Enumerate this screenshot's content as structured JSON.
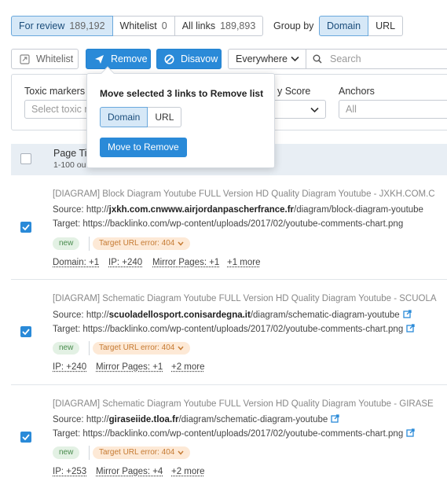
{
  "tabs": [
    {
      "label": "For review",
      "count": "189,192"
    },
    {
      "label": "Whitelist",
      "count": "0"
    },
    {
      "label": "All links",
      "count": "189,893"
    }
  ],
  "group_by": {
    "label": "Group by",
    "options": [
      "Domain",
      "URL"
    ],
    "selected": "Domain"
  },
  "actions": {
    "whitelist": "Whitelist",
    "remove": "Remove",
    "disavow": "Disavow",
    "scope": "Everywhere",
    "search_placeholder": "Search"
  },
  "filters": {
    "toxic_markers_label": "Toxic markers",
    "toxic_markers_placeholder": "Select toxic m",
    "score_label": "y Score",
    "anchors_label": "Anchors",
    "anchors_value": "All"
  },
  "table_header": {
    "title": "Page Tit",
    "subtitle": "1-100 ou"
  },
  "rows": [
    {
      "title": "[DIAGRAM] Block Diagram Youtube FULL Version HD Quality Diagram Youtube - JXKH.COM.C",
      "source_label": "Source:",
      "source_prefix": "http://",
      "source_domain": "jxkh.com.cnwww.airjordanpascherfrance.fr",
      "source_path": "/diagram/block-diagram-youtube",
      "target_label": "Target:",
      "target_url": "https://backlinko.com/wp-content/uploads/2017/02/youtube-comments-chart.png",
      "badge": "new",
      "error": "Target URL error: 404",
      "metrics": [
        "Domain: +1",
        "IP: +240",
        "Mirror Pages: +1",
        "+1 more"
      ]
    },
    {
      "title": "[DIAGRAM] Schematic Diagram Youtube FULL Version HD Quality Diagram Youtube - SCUOLA",
      "source_label": "Source:",
      "source_prefix": "http://",
      "source_domain": "scuoladellosport.conisardegna.it",
      "source_path": "/diagram/schematic-diagram-youtube",
      "target_label": "Target:",
      "target_url": "https://backlinko.com/wp-content/uploads/2017/02/youtube-comments-chart.png",
      "badge": "new",
      "error": "Target URL error: 404",
      "metrics": [
        "IP: +240",
        "Mirror Pages: +1",
        "+2 more"
      ]
    },
    {
      "title": "[DIAGRAM] Schematic Diagram Youtube FULL Version HD Quality Diagram Youtube - GIRASE",
      "source_label": "Source:",
      "source_prefix": "http://",
      "source_domain": "giraseiide.tloa.fr",
      "source_path": "/diagram/schematic-diagram-youtube",
      "target_label": "Target:",
      "target_url": "https://backlinko.com/wp-content/uploads/2017/02/youtube-comments-chart.png",
      "badge": "new",
      "error": "Target URL error: 404",
      "metrics": [
        "IP: +253",
        "Mirror Pages: +4",
        "+2 more"
      ]
    }
  ],
  "popover": {
    "title": "Move selected 3 links to Remove list",
    "options": [
      "Domain",
      "URL"
    ],
    "selected": "Domain",
    "confirm": "Move to Remove"
  },
  "colors": {
    "accent": "#2a8ad8",
    "selected_bg": "#d6e8f7",
    "header_bg": "#e8eef4",
    "new_bg": "#e3f1e4",
    "error_bg": "#fde9d6"
  }
}
